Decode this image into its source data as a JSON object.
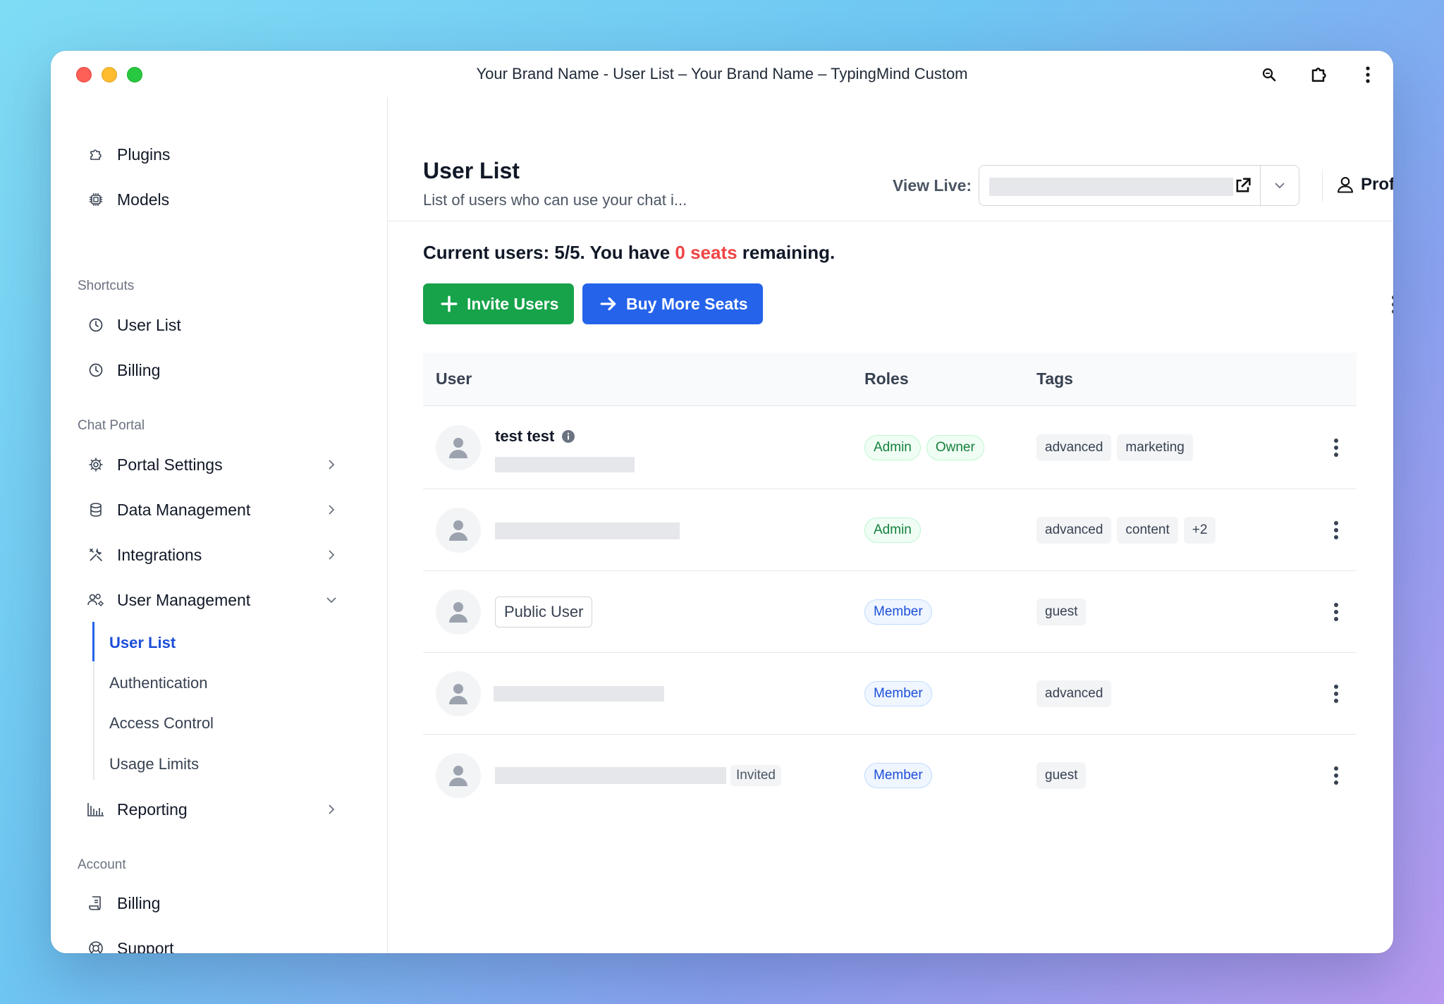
{
  "window": {
    "title": "Your Brand Name - User List – Your Brand Name – TypingMind Custom"
  },
  "sidebar": {
    "top_items": [
      {
        "label": "Plugins",
        "icon": "puzzle-icon"
      },
      {
        "label": "Models",
        "icon": "chip-icon"
      }
    ],
    "shortcuts_label": "Shortcuts",
    "shortcuts": [
      {
        "label": "User List",
        "icon": "clock-icon"
      },
      {
        "label": "Billing",
        "icon": "clock-icon"
      }
    ],
    "chat_portal_label": "Chat Portal",
    "chat_portal": [
      {
        "label": "Portal Settings",
        "icon": "gear-icon"
      },
      {
        "label": "Data Management",
        "icon": "database-icon"
      },
      {
        "label": "Integrations",
        "icon": "tools-icon"
      },
      {
        "label": "User Management",
        "icon": "users-gear-icon"
      }
    ],
    "user_management_sub": [
      {
        "label": "User List",
        "active": true
      },
      {
        "label": "Authentication"
      },
      {
        "label": "Access Control"
      },
      {
        "label": "Usage Limits"
      }
    ],
    "reporting": {
      "label": "Reporting",
      "icon": "bar-chart-icon"
    },
    "account_label": "Account",
    "account": [
      {
        "label": "Billing",
        "icon": "receipt-icon"
      },
      {
        "label": "Support",
        "icon": "lifebuoy-icon"
      }
    ]
  },
  "header": {
    "title": "User List",
    "subtitle": "List of users who can use your chat i...",
    "view_live_label": "View Live:",
    "profile_label": "Profile"
  },
  "summary": {
    "prefix": "Current users: 5/5. You have ",
    "seats": "0 seats",
    "suffix": " remaining."
  },
  "actions": {
    "invite_label": "Invite Users",
    "buy_label": "Buy More Seats"
  },
  "table": {
    "columns": {
      "user": "User",
      "roles": "Roles",
      "tags": "Tags"
    },
    "rows": [
      {
        "name": "test test",
        "roles": [
          "Admin",
          "Owner"
        ],
        "tags": [
          "advanced",
          "marketing"
        ]
      },
      {
        "name": "",
        "roles": [
          "Admin"
        ],
        "tags": [
          "advanced",
          "content",
          "+2"
        ]
      },
      {
        "name": "Public User",
        "roles": [
          "Member"
        ],
        "tags": [
          "guest"
        ]
      },
      {
        "name": "",
        "roles": [
          "Member"
        ],
        "tags": [
          "advanced"
        ]
      },
      {
        "name": "",
        "status": "Invited",
        "roles": [
          "Member"
        ],
        "tags": [
          "guest"
        ]
      }
    ]
  },
  "colors": {
    "accent_blue": "#2563eb",
    "invite_green": "#16a34a",
    "warning_red": "#ef4444"
  }
}
